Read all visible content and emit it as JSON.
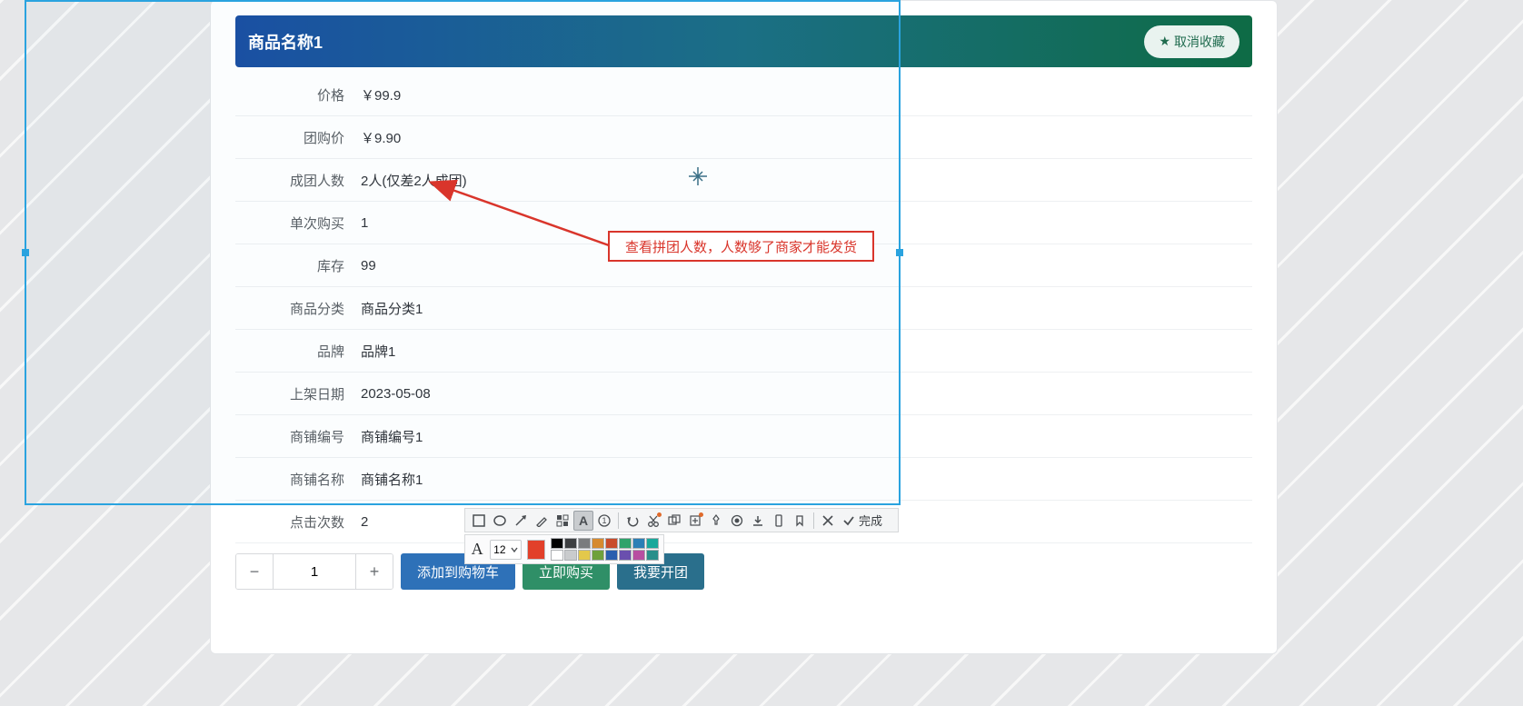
{
  "header": {
    "title": "商品名称1",
    "unfavorite_label": "取消收藏",
    "star": "★"
  },
  "rows": [
    {
      "label": "价格",
      "value": "￥99.9"
    },
    {
      "label": "团购价",
      "value": "￥9.90"
    },
    {
      "label": "成团人数",
      "value": "2人(仅差2人成团)"
    },
    {
      "label": "单次购买",
      "value": "1"
    },
    {
      "label": "库存",
      "value": "99"
    },
    {
      "label": "商品分类",
      "value": "商品分类1"
    },
    {
      "label": "品牌",
      "value": "品牌1"
    },
    {
      "label": "上架日期",
      "value": "2023-05-08"
    },
    {
      "label": "商铺编号",
      "value": "商铺编号1"
    },
    {
      "label": "商铺名称",
      "value": "商铺名称1"
    },
    {
      "label": "点击次数",
      "value": "2"
    }
  ],
  "qty_value": "1",
  "actions": {
    "add_cart": "添加到购物车",
    "buy_now": "立即购买",
    "start_group": "我要开团"
  },
  "annotation": {
    "note": "查看拼团人数，人数够了商家才能发货",
    "arrow_color": "#d9352b",
    "crosshair_color": "#3a6f86"
  },
  "toolbar_done": "完成",
  "font_size": "12",
  "current_color": "#e2402a",
  "palette": [
    "#000000",
    "#3d3f41",
    "#7a7c7e",
    "#d68a2e",
    "#c94b2a",
    "#2fa36a",
    "#2c7fb6",
    "#1aa89b",
    "#ffffff",
    "#c9cbcd",
    "#e3c84b",
    "#6fa13c",
    "#2a5fae",
    "#6a4fae",
    "#b84fa1",
    "#2a8f8a"
  ]
}
